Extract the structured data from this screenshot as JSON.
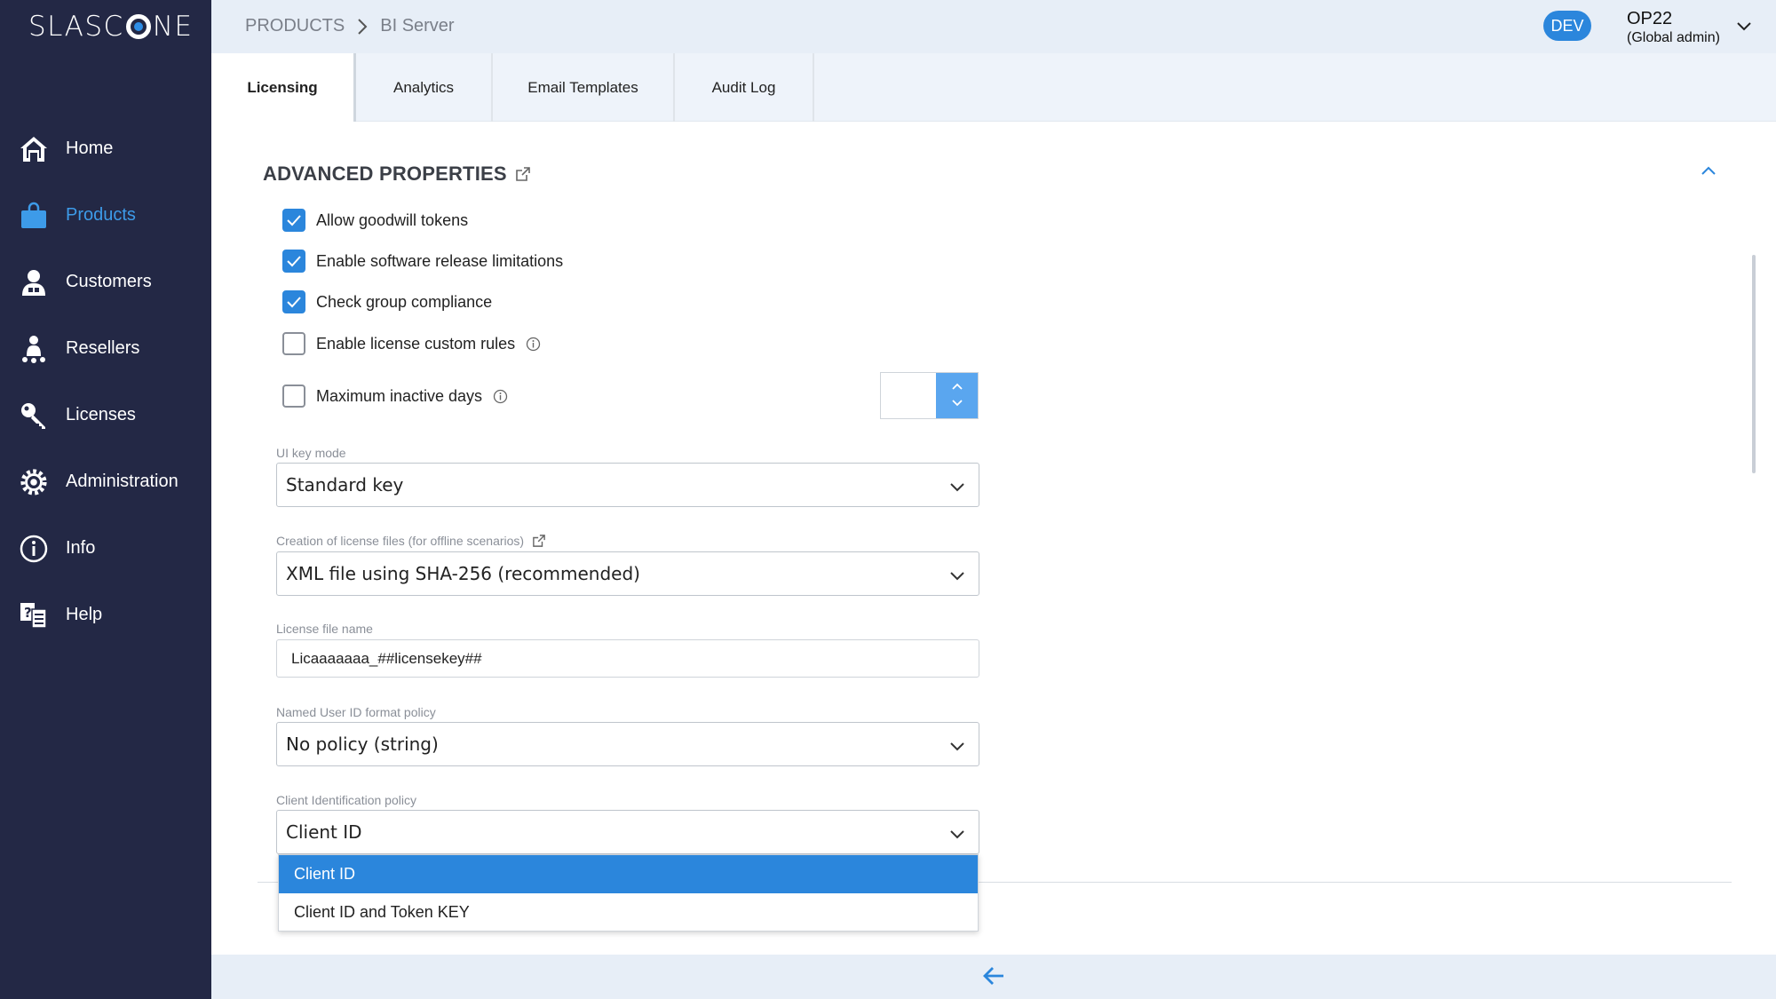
{
  "app": {
    "logo_text_left": "SLASC",
    "logo_text_right": "NE"
  },
  "sidebar": {
    "items": [
      {
        "label": "Home",
        "icon": "home-icon"
      },
      {
        "label": "Products",
        "icon": "shopping-bag-icon",
        "active": true
      },
      {
        "label": "Customers",
        "icon": "customer-icon"
      },
      {
        "label": "Resellers",
        "icon": "reseller-icon"
      },
      {
        "label": "Licenses",
        "icon": "key-icon"
      },
      {
        "label": "Administration",
        "icon": "gear-icon"
      },
      {
        "label": "Info",
        "icon": "info-icon"
      },
      {
        "label": "Help",
        "icon": "help-icon"
      }
    ]
  },
  "header": {
    "breadcrumb": [
      "PRODUCTS",
      "BI Server"
    ],
    "env_badge": "DEV",
    "user_name": "OP22",
    "user_role": "(Global admin)"
  },
  "tabs": [
    {
      "label": "Licensing",
      "active": true
    },
    {
      "label": "Analytics"
    },
    {
      "label": "Email Templates"
    },
    {
      "label": "Audit Log"
    }
  ],
  "section": {
    "title": "ADVANCED PROPERTIES",
    "checkboxes": [
      {
        "label": "Allow goodwill tokens",
        "checked": true
      },
      {
        "label": "Enable software release limitations",
        "checked": true
      },
      {
        "label": "Check group compliance",
        "checked": true
      },
      {
        "label": "Enable license custom rules",
        "checked": false,
        "info": true
      },
      {
        "label": "Maximum inactive days",
        "checked": false,
        "info": true
      }
    ],
    "max_inactive_days_value": "",
    "ui_key_mode": {
      "label": "UI key mode",
      "value": "Standard key"
    },
    "license_file_creation": {
      "label": "Creation of license files (for offline scenarios)",
      "value": "XML file using SHA-256 (recommended)"
    },
    "license_file_name": {
      "label": "License file name",
      "value": "Licaaaaaaa_##licensekey##"
    },
    "named_user_id_policy": {
      "label": "Named User ID format policy",
      "value": "No policy (string)"
    },
    "client_identification_policy": {
      "label": "Client Identification policy",
      "value": "Client ID",
      "options": [
        {
          "label": "Client ID",
          "selected": true
        },
        {
          "label": "Client ID and Token KEY",
          "selected": false
        }
      ]
    }
  },
  "colors": {
    "sidebar_bg": "#232845",
    "accent": "#2b86dc",
    "active_nav": "#3d9be9",
    "header_bg": "#e7eef7"
  }
}
